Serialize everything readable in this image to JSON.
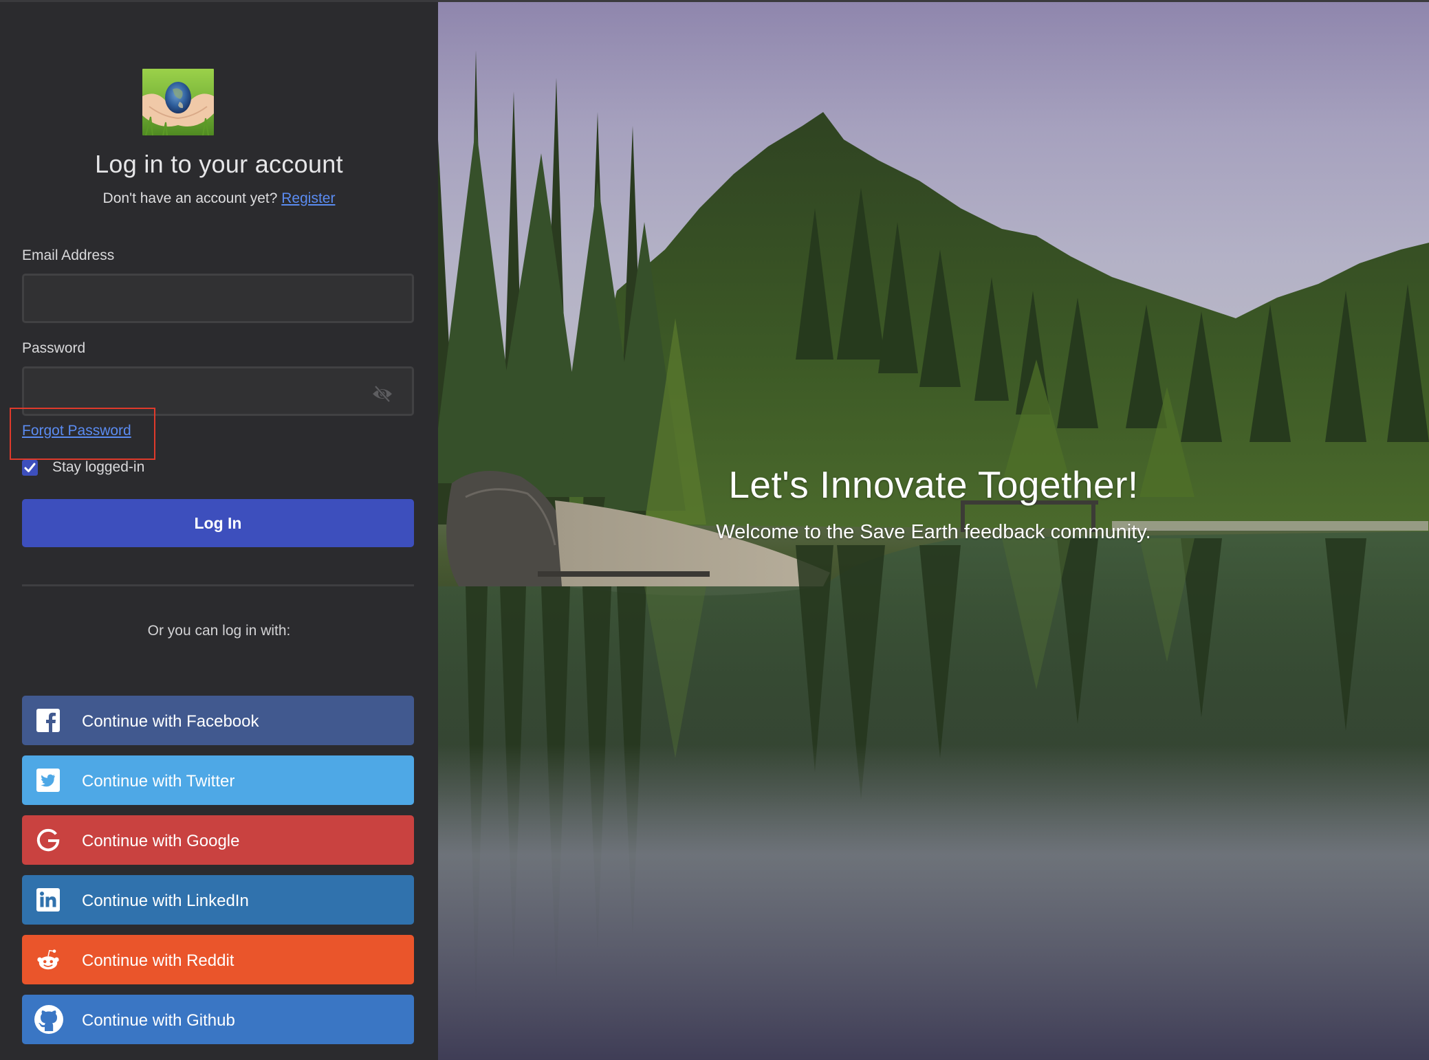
{
  "login": {
    "title": "Log in to your account",
    "no_account_text": "Don't have an account yet?",
    "register_link": "Register",
    "email_label": "Email Address",
    "email_value": "",
    "email_placeholder": "",
    "password_label": "Password",
    "password_value": "",
    "password_placeholder": "",
    "password_toggle_icon": "eye-off-icon",
    "forgot_password_link": "Forgot Password",
    "stay_logged_in_label": "Stay logged-in",
    "stay_logged_in_checked": true,
    "login_button": "Log In",
    "alt_login_text": "Or you can log in with:"
  },
  "social_logins": [
    {
      "label": "Continue with Facebook",
      "icon": "facebook-icon",
      "color": "#41598f"
    },
    {
      "label": "Continue with Twitter",
      "icon": "twitter-icon",
      "color": "#4ea8e6"
    },
    {
      "label": "Continue with Google",
      "icon": "google-icon",
      "color": "#c94240"
    },
    {
      "label": "Continue with LinkedIn",
      "icon": "linkedin-icon",
      "color": "#3072ad"
    },
    {
      "label": "Continue with Reddit",
      "icon": "reddit-icon",
      "color": "#ea552b"
    },
    {
      "label": "Continue with Github",
      "icon": "github-icon",
      "color": "#3a76c4"
    }
  ],
  "hero": {
    "headline": "Let's Innovate Together!",
    "subheadline": "Welcome to the Save Earth feedback community."
  },
  "colors": {
    "panel_bg": "#2b2b2e",
    "accent": "#3d4fbd",
    "link": "#5b8cf2",
    "highlight_box": "#e03a2b"
  }
}
